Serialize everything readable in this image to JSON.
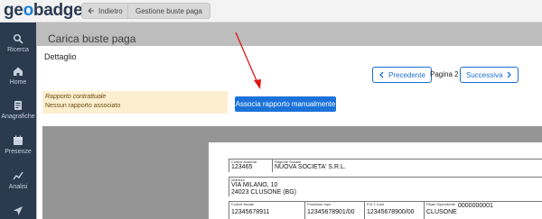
{
  "app": {
    "logo_pre": "ge",
    "logo_o": "o",
    "logo_post": "badge",
    "back_label": "Indietro",
    "breadcrumb": "Gestione buste paga",
    "page_title": "Carica buste paga"
  },
  "sidebar": {
    "items": [
      {
        "label": "Ricerca",
        "icon": "search-icon"
      },
      {
        "label": "Home",
        "icon": "home-icon"
      },
      {
        "label": "Anagrafiche",
        "icon": "people-icon"
      },
      {
        "label": "Presenze",
        "icon": "calendar-icon"
      },
      {
        "label": "Analisi",
        "icon": "chart-icon"
      },
      {
        "label": "",
        "icon": "send-icon"
      }
    ]
  },
  "modal": {
    "title": "Dettaglio",
    "prev_label": "Precedente",
    "page_label": "Pagina 2",
    "next_label": "Successiva",
    "warning_line1": "Rapporto contrattuale",
    "warning_line2": "Nessun rapporto associato",
    "associate_button": "Associa rapporto manualmente"
  },
  "payslip": {
    "codice_azienda_label": "Codice Azienda",
    "codice_azienda": "123465",
    "ragione_sociale_label": "Ragione Sociale",
    "ragione_sociale": "NUOVA SOCIETA' S.R.L.",
    "indirizzo_label": "Indirizzo",
    "indirizzo_line1": "VIA MILANO, 10",
    "indirizzo_line2": "24023     CLUSONE (BG)",
    "codice_fiscale_label": "Codice fiscale",
    "codice_fiscale": "12345678911",
    "posizione_inps_label": "Posizione Inps",
    "posizione_inps": "12345678901/00",
    "pat_inail_label": "P.A.T. Inail",
    "pat_inail": "12345678900/00",
    "filiale_label": "Filiale Dipendente",
    "filiale": "CLUSONE",
    "codice_extra": "0000000001"
  },
  "colors": {
    "accent": "#1b72d9",
    "sidebar": "#2c3a4f",
    "warning_bg": "#fcefcf",
    "arrow": "#e01515"
  }
}
